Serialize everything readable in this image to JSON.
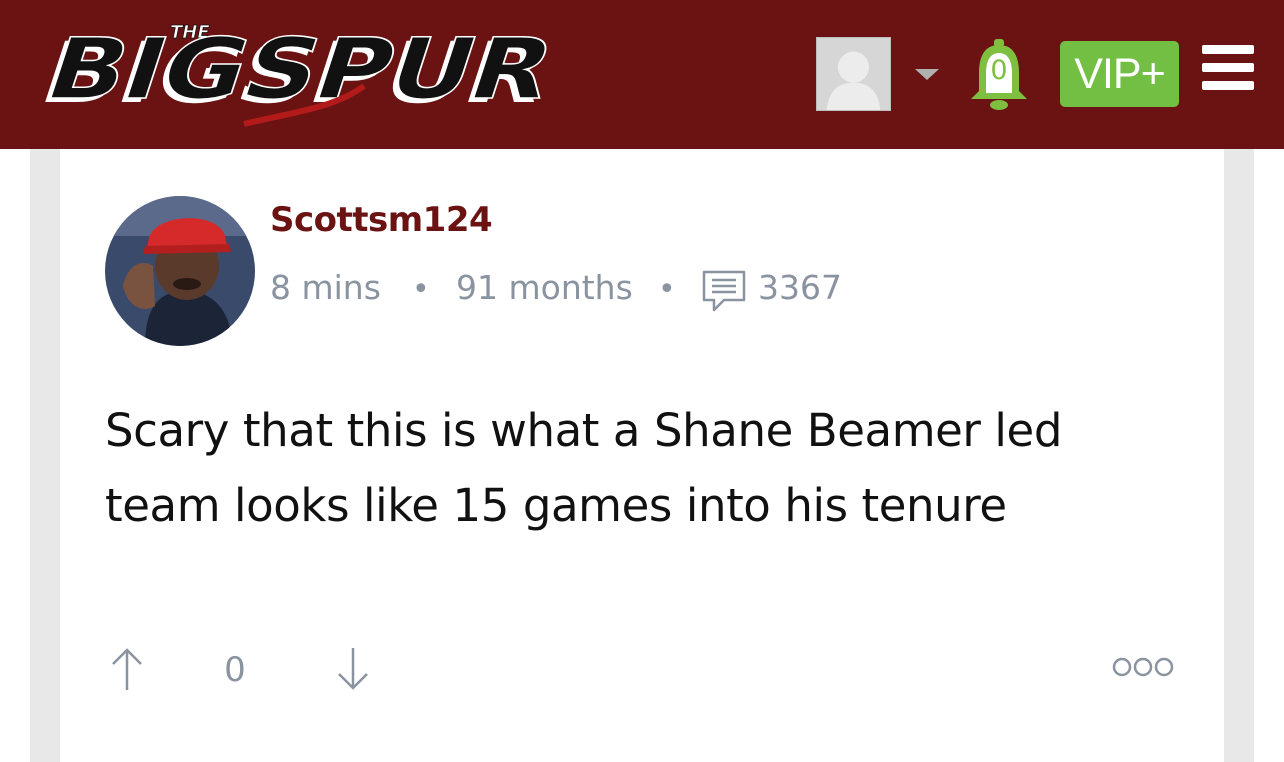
{
  "header": {
    "logo_small": "THE",
    "logo_text": "BIGSPUR",
    "notification_count": "0",
    "vip_label": "VIP+"
  },
  "post": {
    "username": "Scottsm124",
    "time_ago": "8 mins",
    "membership": "91 months",
    "post_count": "3367",
    "body": "Scary that this is what a Shane Beamer led team looks like 15 games into his tenure",
    "vote_count": "0"
  },
  "colors": {
    "header_bg": "#6b1212",
    "username": "#6b1212",
    "vip_green": "#72bf44",
    "meta_gray": "#8a94a0"
  },
  "icons": [
    "user-avatar-icon",
    "caret-down-icon",
    "bell-icon",
    "menu-icon",
    "comment-icon",
    "arrow-up-icon",
    "arrow-down-icon",
    "more-options-icon"
  ]
}
